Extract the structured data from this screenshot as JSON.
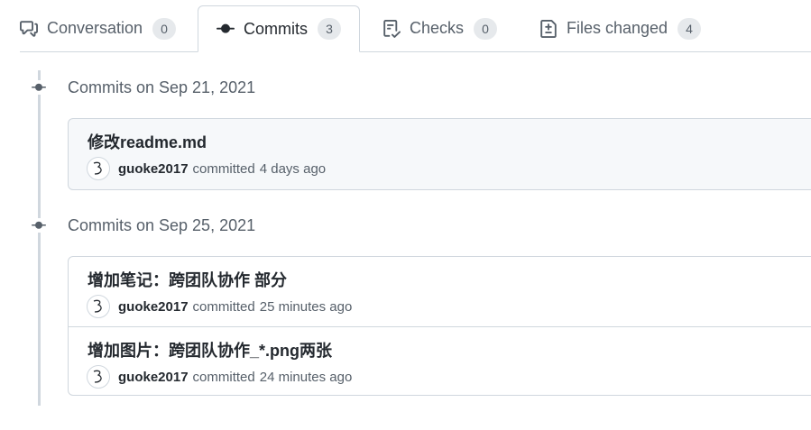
{
  "tabs": [
    {
      "label": "Conversation",
      "count": "0",
      "icon": "comment-discussion-icon"
    },
    {
      "label": "Commits",
      "count": "3",
      "icon": "git-commit-icon",
      "selected": true
    },
    {
      "label": "Checks",
      "count": "0",
      "icon": "checklist-icon"
    },
    {
      "label": "Files changed",
      "count": "4",
      "icon": "file-diff-icon"
    }
  ],
  "groups": [
    {
      "label": "Commits on Sep 21, 2021",
      "commits": [
        {
          "title": "修改readme.md",
          "author": "guoke2017",
          "verb": "committed",
          "time": "4 days ago"
        }
      ]
    },
    {
      "label": "Commits on Sep 25, 2021",
      "commits": [
        {
          "title": "增加笔记：跨团队协作 部分",
          "author": "guoke2017",
          "verb": "committed",
          "time": "25 minutes ago"
        },
        {
          "title": "增加图片：跨团队协作_*.png两张",
          "author": "guoke2017",
          "verb": "committed",
          "time": "24 minutes ago"
        }
      ]
    }
  ],
  "colors": {
    "border": "#d0d7de",
    "muted_text": "#57606a",
    "text": "#24292f",
    "counter_bg": "#e6e9ec",
    "box_bg": "#f6f8fa"
  }
}
